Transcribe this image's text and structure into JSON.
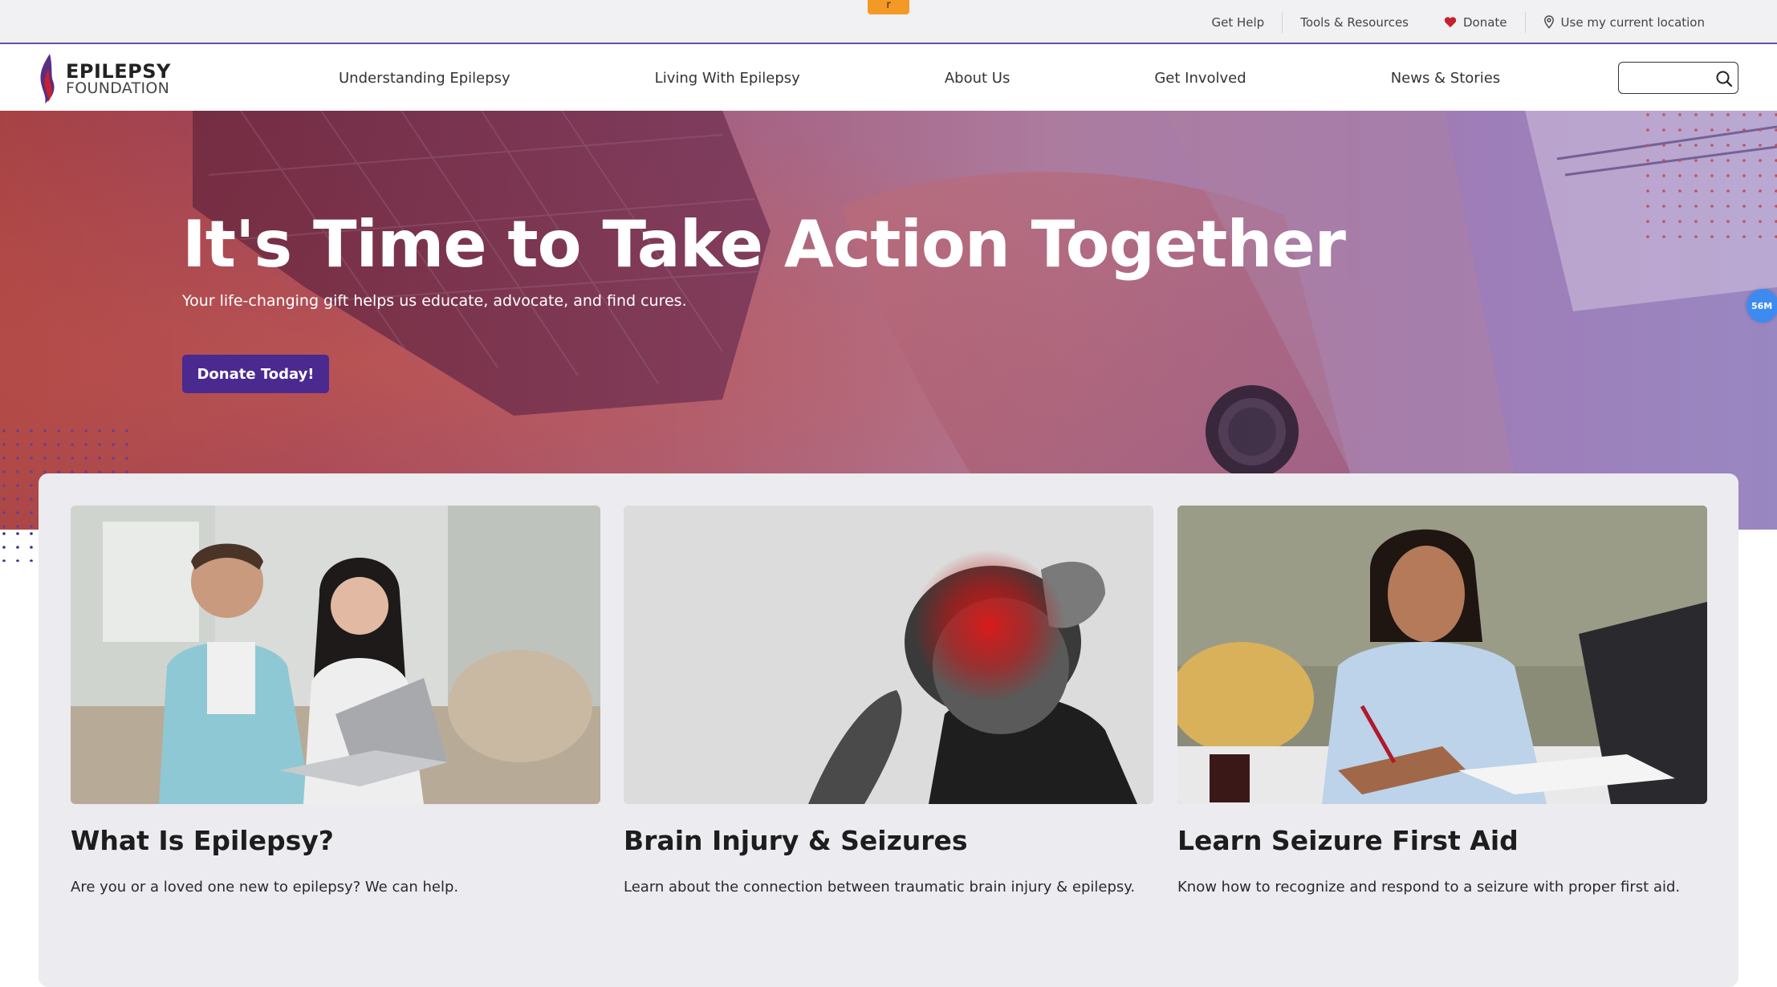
{
  "utility": {
    "tab_label": "r",
    "links": [
      {
        "label": "Get Help"
      },
      {
        "label": "Tools & Resources"
      },
      {
        "label": "Donate",
        "icon": "heart-icon"
      },
      {
        "label": "Use my current location",
        "icon": "location-pin-icon"
      }
    ]
  },
  "header": {
    "logo_line1": "EPILEPSY",
    "logo_line2": "FOUNDATION",
    "nav": [
      {
        "label": "Understanding Epilepsy"
      },
      {
        "label": "Living With Epilepsy"
      },
      {
        "label": "About Us"
      },
      {
        "label": "Get Involved"
      },
      {
        "label": "News & Stories"
      }
    ],
    "search_value": "",
    "search_placeholder": ""
  },
  "hero": {
    "title": "It's Time to Take Action Together",
    "subtitle": "Your life-changing gift helps us educate, advocate, and find cures.",
    "button_label": "Donate Today!"
  },
  "badge": {
    "label": "56M"
  },
  "cards": [
    {
      "title": "What Is Epilepsy?",
      "description": "Are you or a loved one new to epilepsy? We can help."
    },
    {
      "title": "Brain Injury & Seizures",
      "description": "Learn about the connection between traumatic brain injury & epilepsy."
    },
    {
      "title": "Learn Seizure First Aid",
      "description": "Know how to recognize and respond to a seizure with proper first aid."
    }
  ],
  "colors": {
    "brand_purple": "#4a2a8f",
    "accent_red": "#c8202f",
    "utility_tab": "#f39a26"
  }
}
